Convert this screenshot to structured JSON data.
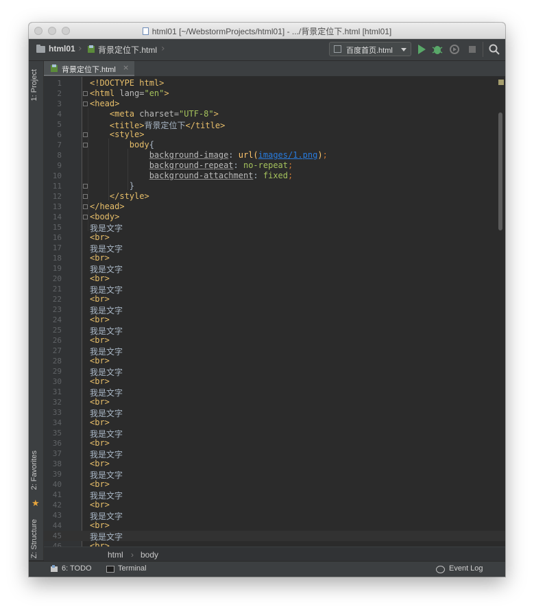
{
  "window": {
    "title": "html01 [~/WebstormProjects/html01] - .../背景定位下.html [html01]"
  },
  "navbar": {
    "project": "html01",
    "file": "背景定位下.html",
    "run_config": "百度首页.html"
  },
  "left_tools": {
    "project": "1: Project",
    "favorites": "2: Favorites",
    "structure": "Z: Structure"
  },
  "tab": {
    "label": "背景定位下.html",
    "close": "×"
  },
  "breadcrumbs": [
    "html",
    "body"
  ],
  "bottom": {
    "todo": "6: TODO",
    "terminal": "Terminal",
    "event_log": "Event Log"
  },
  "colors": {
    "tag": "#e8bf6a",
    "attribute": "#bababa",
    "string": "#a5c25c",
    "url": "#287bde",
    "editor_bg": "#2b2b2b"
  },
  "code_lines": [
    [
      {
        "t": "<!DOCTYPE html>",
        "c": "tag"
      }
    ],
    [
      {
        "t": "<html ",
        "c": "tag"
      },
      {
        "t": "lang=",
        "c": "attr"
      },
      {
        "t": "\"en\"",
        "c": "val"
      },
      {
        "t": ">",
        "c": "tag"
      }
    ],
    [
      {
        "t": "<head>",
        "c": "tag"
      }
    ],
    [
      {
        "t": "    <meta ",
        "c": "tag"
      },
      {
        "t": "charset=",
        "c": "attr"
      },
      {
        "t": "\"UTF-8\"",
        "c": "val"
      },
      {
        "t": ">",
        "c": "tag"
      }
    ],
    [
      {
        "t": "    <title>",
        "c": "tag"
      },
      {
        "t": "背景定位下",
        "c": "plain"
      },
      {
        "t": "</title>",
        "c": "tag"
      }
    ],
    [
      {
        "t": "    <style>",
        "c": "tag"
      }
    ],
    [
      {
        "t": "        body",
        "c": "sel"
      },
      {
        "t": "{",
        "c": "plain"
      }
    ],
    [
      {
        "t": "            ",
        "c": "plain"
      },
      {
        "t": "background-image",
        "c": "prop"
      },
      {
        "t": ": ",
        "c": "plain"
      },
      {
        "t": "url(",
        "c": "fn"
      },
      {
        "t": "images/1.png",
        "c": "url"
      },
      {
        "t": ")",
        "c": "fn"
      },
      {
        "t": ";",
        "c": "punc"
      }
    ],
    [
      {
        "t": "            ",
        "c": "plain"
      },
      {
        "t": "background-repeat",
        "c": "prop"
      },
      {
        "t": ": ",
        "c": "plain"
      },
      {
        "t": "no-repeat",
        "c": "kw"
      },
      {
        "t": ";",
        "c": "punc"
      }
    ],
    [
      {
        "t": "            ",
        "c": "plain"
      },
      {
        "t": "background-attachment",
        "c": "prop"
      },
      {
        "t": ": ",
        "c": "plain"
      },
      {
        "t": "fixed",
        "c": "kw"
      },
      {
        "t": ";",
        "c": "punc"
      }
    ],
    [
      {
        "t": "        }",
        "c": "plain"
      }
    ],
    [
      {
        "t": "    </style>",
        "c": "tag"
      }
    ],
    [
      {
        "t": "</head>",
        "c": "tag"
      }
    ],
    [
      {
        "t": "<body>",
        "c": "tag"
      }
    ],
    [
      {
        "t": "我是文字",
        "c": "plain"
      }
    ],
    [
      {
        "t": "<br>",
        "c": "tag"
      }
    ],
    [
      {
        "t": "我是文字",
        "c": "plain"
      }
    ],
    [
      {
        "t": "<br>",
        "c": "tag"
      }
    ],
    [
      {
        "t": "我是文字",
        "c": "plain"
      }
    ],
    [
      {
        "t": "<br>",
        "c": "tag"
      }
    ],
    [
      {
        "t": "我是文字",
        "c": "plain"
      }
    ],
    [
      {
        "t": "<br>",
        "c": "tag"
      }
    ],
    [
      {
        "t": "我是文字",
        "c": "plain"
      }
    ],
    [
      {
        "t": "<br>",
        "c": "tag"
      }
    ],
    [
      {
        "t": "我是文字",
        "c": "plain"
      }
    ],
    [
      {
        "t": "<br>",
        "c": "tag"
      }
    ],
    [
      {
        "t": "我是文字",
        "c": "plain"
      }
    ],
    [
      {
        "t": "<br>",
        "c": "tag"
      }
    ],
    [
      {
        "t": "我是文字",
        "c": "plain"
      }
    ],
    [
      {
        "t": "<br>",
        "c": "tag"
      }
    ],
    [
      {
        "t": "我是文字",
        "c": "plain"
      }
    ],
    [
      {
        "t": "<br>",
        "c": "tag"
      }
    ],
    [
      {
        "t": "我是文字",
        "c": "plain"
      }
    ],
    [
      {
        "t": "<br>",
        "c": "tag"
      }
    ],
    [
      {
        "t": "我是文字",
        "c": "plain"
      }
    ],
    [
      {
        "t": "<br>",
        "c": "tag"
      }
    ],
    [
      {
        "t": "我是文字",
        "c": "plain"
      }
    ],
    [
      {
        "t": "<br>",
        "c": "tag"
      }
    ],
    [
      {
        "t": "我是文字",
        "c": "plain"
      }
    ],
    [
      {
        "t": "<br>",
        "c": "tag"
      }
    ],
    [
      {
        "t": "我是文字",
        "c": "plain"
      }
    ],
    [
      {
        "t": "<br>",
        "c": "tag"
      }
    ],
    [
      {
        "t": "我是文字",
        "c": "plain"
      }
    ],
    [
      {
        "t": "<br>",
        "c": "tag"
      }
    ],
    [
      {
        "t": "我是文字",
        "c": "plain"
      }
    ],
    [
      {
        "t": "<br>",
        "c": "tag"
      }
    ]
  ],
  "current_line": 45
}
